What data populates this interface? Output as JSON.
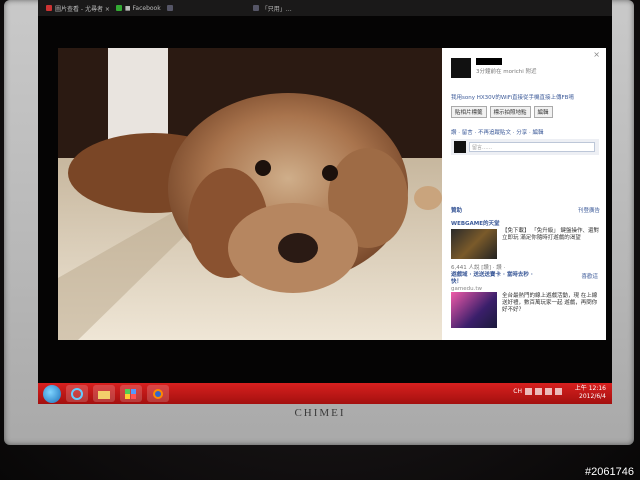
{
  "tabs": [
    {
      "label": "圖片查看 - 尤尋者 ×",
      "favicon": "red"
    },
    {
      "label": "■ Facebook",
      "favicon": "green"
    },
    {
      "label": "",
      "favicon": "blue"
    },
    {
      "label": "「只用」…",
      "favicon": "blue"
    }
  ],
  "sidebar": {
    "close": "×",
    "meta": "3分鐘前在 morichi 附近",
    "caption": "我用sony HX30V的WiFi直接從手機直接上傳FB唷",
    "tag_button": "貼相片標籤",
    "location_button": "標示拍照地點",
    "edit_button": "編輯",
    "actions": "讚 · 留言 · 不再追蹤貼文 · 分享 · 編輯",
    "comment_placeholder": "留言……",
    "ads_heading": "贊助",
    "ads_link": "刊登廣告",
    "ad1_title": "WEBGAME的天堂",
    "ad1_text": "【免下載】 「免升級」 鍵盤操作、還對 立即玩 滿足你隨時打遊戲的渴望",
    "ad1_stats": "6,441 人說 [讚] · 讚 ·",
    "ad2_title": "遊戲域 · 送送送寶卡 · 當時去秒 · 快！",
    "ad2_link": "gamedu.tw",
    "ad2_like": "喜歡這",
    "ad2_text": "全台最熱門的線上遊戲活動，現 在上線送好禮，數百萬玩家一起 遊戲，再問你好不好？"
  },
  "taskbar": {
    "lang": "CH",
    "time": "上午 12:16",
    "date": "2012/6/4"
  },
  "brand": "CHIMEI",
  "watermark": "#2061746",
  "colors": {
    "taskbar": "#c61a19",
    "fb_link": "#3b5998"
  }
}
